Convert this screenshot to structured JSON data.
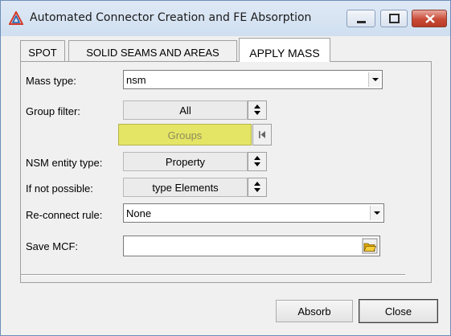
{
  "window": {
    "title": "Automated Connector Creation and FE Absorption"
  },
  "tabs": [
    {
      "label": "SPOT"
    },
    {
      "label": "SOLID SEAMS AND AREAS"
    },
    {
      "label": "APPLY MASS"
    }
  ],
  "form": {
    "mass_type": {
      "label": "Mass type:",
      "value": "nsm"
    },
    "group_filter": {
      "label": "Group filter:",
      "value": "All",
      "groups_label": "Groups"
    },
    "nsm_entity_type": {
      "label": "NSM entity type:",
      "value": "Property"
    },
    "if_not_possible": {
      "label": "If not possible:",
      "value": "type Elements"
    },
    "reconnect_rule": {
      "label": "Re-connect rule:",
      "value": "None"
    },
    "save_mcf": {
      "label": "Save MCF:",
      "value": ""
    }
  },
  "buttons": {
    "absorb": "Absorb",
    "close": "Close"
  },
  "colors": {
    "groups_button": "#e5e565",
    "groups_text": "#8c8c5a",
    "close_window_button": "#c94b37"
  },
  "icons": {
    "app": "triangle-app-icon",
    "minimize": "minimize-icon",
    "maximize": "maximize-icon",
    "close": "close-icon",
    "dropdown": "chevron-down-icon",
    "spin": "up-down-arrows-icon",
    "reset": "skip-to-start-icon",
    "browse": "folder-open-icon"
  }
}
